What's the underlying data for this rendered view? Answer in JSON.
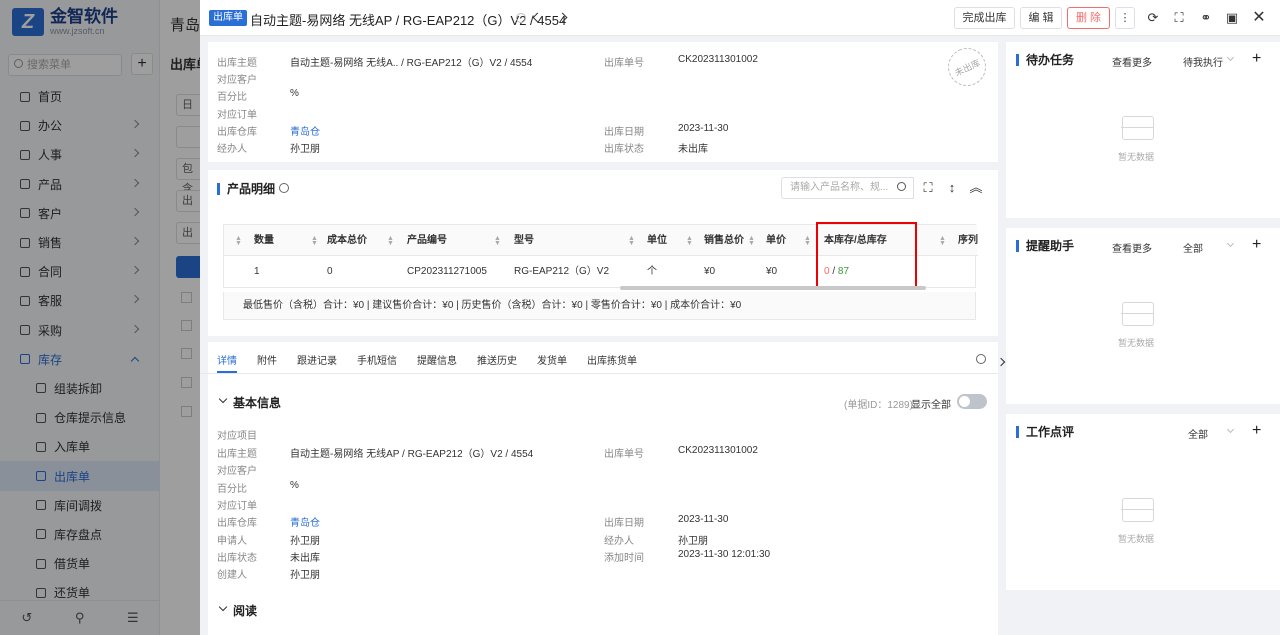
{
  "app": {
    "logo_mark": "Z",
    "logo_title": "金智软件",
    "logo_url": "www.jzsoft.cn",
    "page_title": "青岛金",
    "search_placeholder": "搜索菜单",
    "section_title": "出库单",
    "bg_row_labels": [
      "日",
      "",
      "包含",
      "出",
      "出"
    ]
  },
  "sidebar": {
    "items": [
      {
        "label": "首页",
        "icon": "home-icon"
      },
      {
        "label": "办公",
        "icon": "office-icon",
        "chevron": true
      },
      {
        "label": "人事",
        "icon": "people-icon",
        "chevron": true
      },
      {
        "label": "产品",
        "icon": "product-icon",
        "chevron": true
      },
      {
        "label": "客户",
        "icon": "customer-icon",
        "chevron": true
      },
      {
        "label": "销售",
        "icon": "sales-icon",
        "chevron": true
      },
      {
        "label": "合同",
        "icon": "contract-icon",
        "chevron": true
      },
      {
        "label": "客服",
        "icon": "service-icon",
        "chevron": true
      },
      {
        "label": "采购",
        "icon": "purchase-icon",
        "chevron": true
      },
      {
        "label": "库存",
        "icon": "inventory-icon",
        "chevron": true,
        "open": true
      },
      {
        "label": "组装拆卸",
        "icon": "assemble-icon",
        "sub": true
      },
      {
        "label": "仓库提示信息",
        "icon": "warehouse-alert-icon",
        "sub": true
      },
      {
        "label": "入库单",
        "icon": "inbound-icon",
        "sub": true
      },
      {
        "label": "出库单",
        "icon": "outbound-icon",
        "sub": true,
        "active": true
      },
      {
        "label": "库间调拨",
        "icon": "transfer-icon",
        "sub": true
      },
      {
        "label": "库存盘点",
        "icon": "stocktake-icon",
        "sub": true
      },
      {
        "label": "借货单",
        "icon": "borrow-icon",
        "sub": true
      },
      {
        "label": "还货单",
        "icon": "return-icon",
        "sub": true
      }
    ]
  },
  "drawer": {
    "badge": "出库单",
    "title": "自动主题-易网络 无线AP / RG-EAP212（G）V2 / 4554",
    "buttons": {
      "complete": "完成出库",
      "edit": "编 辑",
      "delete": "删 除"
    }
  },
  "header_info": {
    "subject_label": "出库主题",
    "subject_value": "自动主题-易网络 无线A.. / RG-EAP212（G）V2 / 4554",
    "customer_label": "对应客户",
    "percent_label": "百分比",
    "percent_value": "%",
    "order_label": "对应订单",
    "warehouse_label": "出库仓库",
    "warehouse_value": "青岛仓",
    "handler_label": "经办人",
    "handler_value": "孙卫朋",
    "number_label": "出库单号",
    "number_value": "CK202311301002",
    "date_label": "出库日期",
    "date_value": "2023-11-30",
    "status_label": "出库状态",
    "status_value": "未出库",
    "stamp": "未出库"
  },
  "products": {
    "title": "产品明细",
    "search_placeholder": "请输入产品名称、规...",
    "columns": [
      "数量",
      "成本总价",
      "产品编号",
      "型号",
      "单位",
      "销售总价",
      "单价",
      "本库存/总库存",
      "序列"
    ],
    "row": {
      "qty": "1",
      "cost_total": "0",
      "code": "CP202311271005",
      "model": "RG-EAP212（G）V2",
      "unit": "个",
      "sales_total": "¥0",
      "price": "¥0",
      "stock_local": "0",
      "stock_sep": " / ",
      "stock_total": "87"
    },
    "summary": "最低售价（含税）合计：¥0 |   建议售价合计：¥0 |   历史售价（含税）合计：¥0 |   零售价合计：¥0 |   成本价合计：¥0"
  },
  "tabs": [
    "详情",
    "附件",
    "跟进记录",
    "手机短信",
    "提醒信息",
    "推送历史",
    "发货单",
    "出库拣货单"
  ],
  "basic": {
    "title": "基本信息",
    "doc_id": "(单据ID：1289)",
    "show_all": "显示全部",
    "project_label": "对应项目",
    "subject_label": "出库主题",
    "subject_value": "自动主题-易网络 无线AP / RG-EAP212（G）V2 / 4554",
    "customer_label": "对应客户",
    "percent_label": "百分比",
    "percent_value": "%",
    "order_label": "对应订单",
    "warehouse_label": "出库仓库",
    "warehouse_value": "青岛仓",
    "applicant_label": "申请人",
    "applicant_value": "孙卫朋",
    "status_label": "出库状态",
    "status_value": "未出库",
    "creator_label": "创建人",
    "creator_value": "孙卫朋",
    "number_label": "出库单号",
    "number_value": "CK202311301002",
    "date_label": "出库日期",
    "date_value": "2023-11-30",
    "handler_label": "经办人",
    "handler_value": "孙卫朋",
    "added_label": "添加时间",
    "added_value": "2023-11-30 12:01:30"
  },
  "read_section": "阅读",
  "right_panel": {
    "todo": {
      "title": "待办任务",
      "more": "查看更多",
      "filter": "待我执行",
      "empty": "暂无数据"
    },
    "reminder": {
      "title": "提醒助手",
      "more": "查看更多",
      "filter": "全部",
      "empty": "暂无数据"
    },
    "review": {
      "title": "工作点评",
      "filter": "全部",
      "empty": "暂无数据"
    }
  },
  "colors": {
    "accent": "#2a6fd6",
    "danger": "#f56c6c",
    "highlight_box": "#e00000",
    "stock_ok": "#3a9c3a"
  }
}
